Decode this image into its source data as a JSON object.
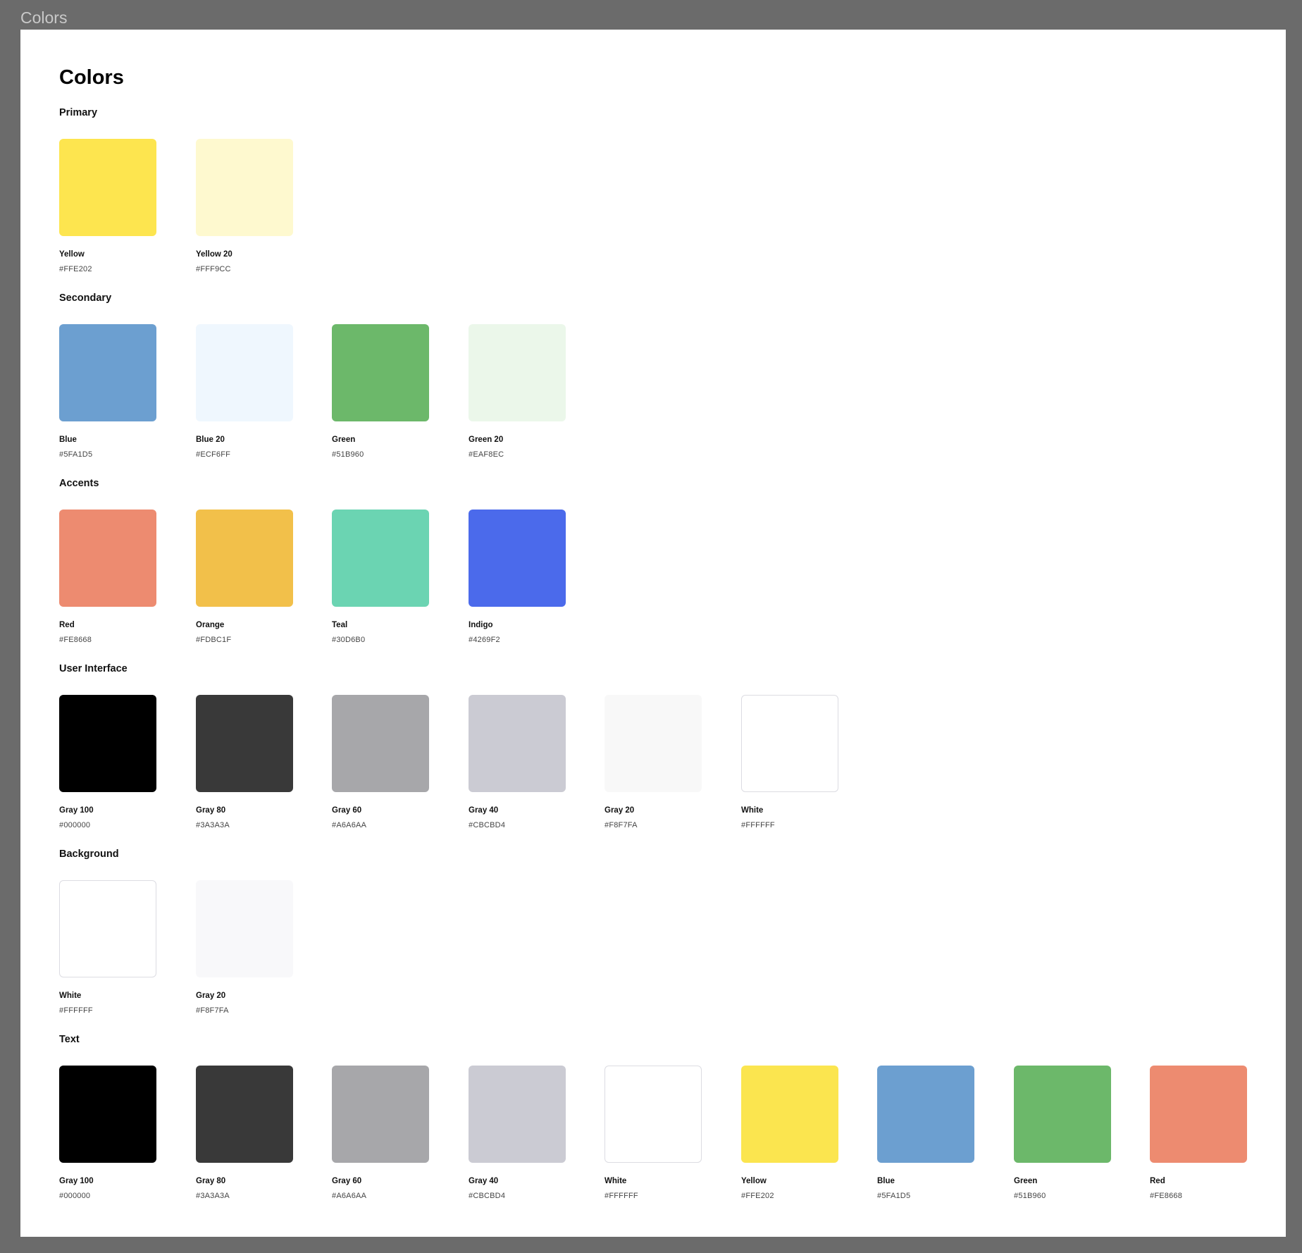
{
  "frame_label": "Colors",
  "title": "Colors",
  "sections": [
    {
      "heading": "Primary",
      "swatches": [
        {
          "name": "Yellow",
          "hex": "#FFE202",
          "color": "#fde54f"
        },
        {
          "name": "Yellow 20",
          "hex": "#FFF9CC",
          "color": "#fef9cf"
        }
      ]
    },
    {
      "heading": "Secondary",
      "swatches": [
        {
          "name": "Blue",
          "hex": "#5FA1D5",
          "color": "#6c9fd0"
        },
        {
          "name": "Blue 20",
          "hex": "#ECF6FF",
          "color": "#eff7fe"
        },
        {
          "name": "Green",
          "hex": "#51B960",
          "color": "#6cb86a"
        },
        {
          "name": "Green 20",
          "hex": "#EAF8EC",
          "color": "#ebf7ea"
        }
      ]
    },
    {
      "heading": "Accents",
      "swatches": [
        {
          "name": "Red",
          "hex": "#FE8668",
          "color": "#ed8b70"
        },
        {
          "name": "Orange",
          "hex": "#FDBC1F",
          "color": "#f2c04a"
        },
        {
          "name": "Teal",
          "hex": "#30D6B0",
          "color": "#6bd4b2"
        },
        {
          "name": "Indigo",
          "hex": "#4269F2",
          "color": "#4b6aeb"
        }
      ]
    },
    {
      "heading": "User Interface",
      "swatches": [
        {
          "name": "Gray 100",
          "hex": "#000000",
          "color": "#000000"
        },
        {
          "name": "Gray 80",
          "hex": "#3A3A3A",
          "color": "#393939"
        },
        {
          "name": "Gray 60",
          "hex": "#A6A6AA",
          "color": "#a7a7aa"
        },
        {
          "name": "Gray 40",
          "hex": "#CBCBD4",
          "color": "#cbcbd3"
        },
        {
          "name": "Gray 20",
          "hex": "#F8F7FA",
          "color": "#f8f8f8"
        },
        {
          "name": "White",
          "hex": "#FFFFFF",
          "color": "#ffffff"
        }
      ]
    },
    {
      "heading": "Background",
      "swatches": [
        {
          "name": "White",
          "hex": "#FFFFFF",
          "color": "#ffffff"
        },
        {
          "name": "Gray 20",
          "hex": "#F8F7FA",
          "color": "#f8f8fa"
        }
      ]
    },
    {
      "heading": "Text",
      "swatches": [
        {
          "name": "Gray 100",
          "hex": "#000000",
          "color": "#000000"
        },
        {
          "name": "Gray 80",
          "hex": "#3A3A3A",
          "color": "#393939"
        },
        {
          "name": "Gray 60",
          "hex": "#A6A6AA",
          "color": "#a7a7aa"
        },
        {
          "name": "Gray 40",
          "hex": "#CBCBD4",
          "color": "#cbcbd3"
        },
        {
          "name": "White",
          "hex": "#FFFFFF",
          "color": "#ffffff"
        },
        {
          "name": "Yellow",
          "hex": "#FFE202",
          "color": "#fbe54f"
        },
        {
          "name": "Blue",
          "hex": "#5FA1D5",
          "color": "#6c9fd0"
        },
        {
          "name": "Green",
          "hex": "#51B960",
          "color": "#6cb86a"
        },
        {
          "name": "Red",
          "hex": "#FE8668",
          "color": "#ed8b70"
        }
      ]
    }
  ]
}
